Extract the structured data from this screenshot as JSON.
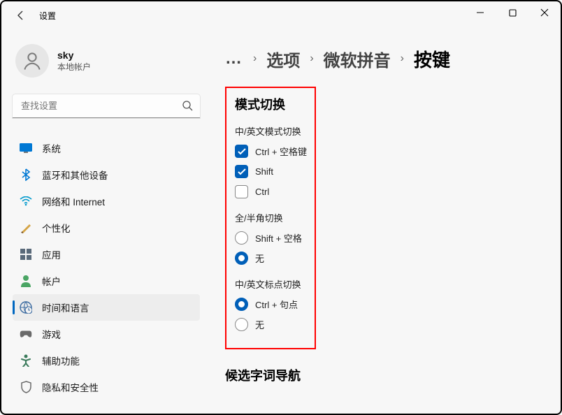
{
  "window": {
    "title": "设置"
  },
  "user": {
    "name": "sky",
    "subtitle": "本地帐户"
  },
  "search": {
    "placeholder": "查找设置"
  },
  "nav": {
    "items": [
      {
        "label": "系统"
      },
      {
        "label": "蓝牙和其他设备"
      },
      {
        "label": "网络和 Internet"
      },
      {
        "label": "个性化"
      },
      {
        "label": "应用"
      },
      {
        "label": "帐户"
      },
      {
        "label": "时间和语言"
      },
      {
        "label": "游戏"
      },
      {
        "label": "辅助功能"
      },
      {
        "label": "隐私和安全性"
      }
    ]
  },
  "breadcrumb": {
    "ellipsis": "…",
    "items": [
      "选项",
      "微软拼音",
      "按键"
    ]
  },
  "sections": {
    "mode_switch": {
      "title": "模式切换",
      "group1_label": "中/英文模式切换",
      "opt1": "Ctrl + 空格键",
      "opt2": "Shift",
      "opt3": "Ctrl",
      "group2_label": "全/半角切换",
      "opt4": "Shift + 空格",
      "opt5": "无",
      "group3_label": "中/英文标点切换",
      "opt6": "Ctrl + 句点",
      "opt7": "无"
    },
    "candidate": {
      "title": "候选字词导航"
    }
  }
}
